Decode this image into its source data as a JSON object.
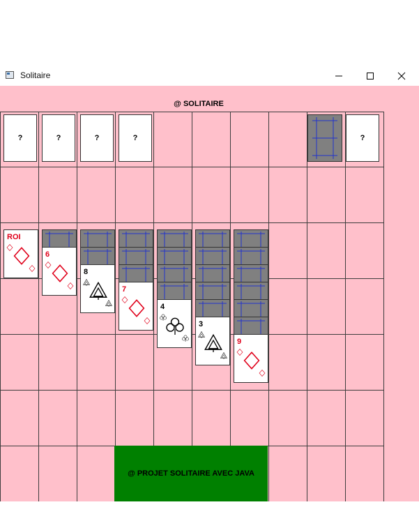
{
  "window": {
    "title": "Solitaire",
    "controls": [
      "minimize",
      "maximize",
      "close"
    ]
  },
  "board": {
    "header": "@ SOLITAIRE",
    "footer": "@ PROJET SOLITAIRE AVEC JAVA",
    "background_color": "#ffc0cb",
    "footer_color": "#008000"
  },
  "top_row": {
    "foundations": [
      "?",
      "?",
      "?",
      "?"
    ],
    "stock": "card-back",
    "waste": "?"
  },
  "tableau": [
    {
      "hidden": 0,
      "rank": "ROI",
      "suit": "diamond",
      "color": "red"
    },
    {
      "hidden": 1,
      "rank": "6",
      "suit": "diamond",
      "color": "red"
    },
    {
      "hidden": 2,
      "rank": "8",
      "suit": "spade",
      "color": "black"
    },
    {
      "hidden": 3,
      "rank": "7",
      "suit": "diamond",
      "color": "red"
    },
    {
      "hidden": 4,
      "rank": "4",
      "suit": "club",
      "color": "black"
    },
    {
      "hidden": 5,
      "rank": "3",
      "suit": "spade",
      "color": "black"
    },
    {
      "hidden": 6,
      "rank": "9",
      "suit": "diamond",
      "color": "red"
    }
  ]
}
